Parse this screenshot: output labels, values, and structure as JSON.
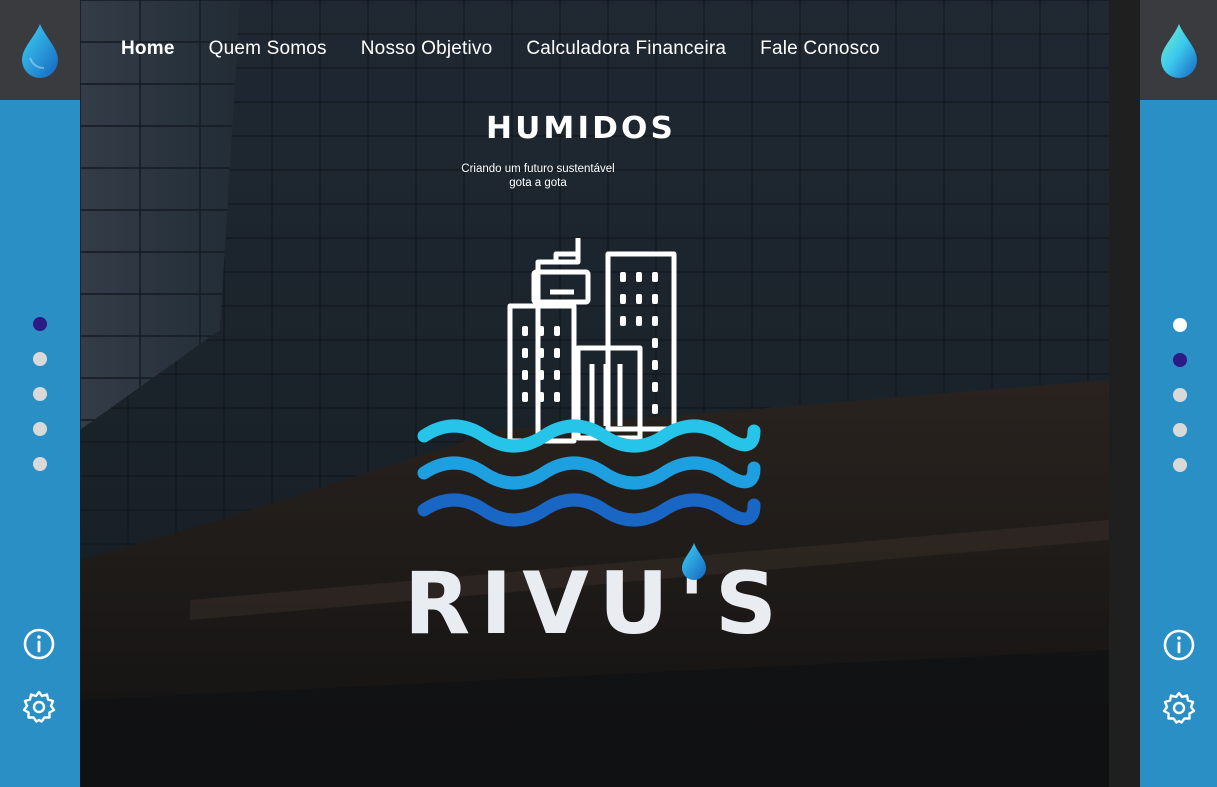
{
  "nav": {
    "items": [
      "Home",
      "Quem Somos",
      "Nosso Objetivo",
      "Calculadora Financeira",
      "Fale Conosco"
    ]
  },
  "brand": {
    "name": "HUMIDOS",
    "tagline_line1": "Criando um futuro sustentável",
    "tagline_line2": "gota a gota"
  },
  "hero": {
    "product_name": "RIVU'S"
  },
  "sidebar_left": {
    "active_dot": 1,
    "dot_count": 5,
    "icons": [
      "water-drop-logo-icon",
      "info-icon",
      "settings-icon"
    ]
  },
  "sidebar_right": {
    "active_dot": 2,
    "dot_count": 5,
    "icons": [
      "water-drop-logo-icon",
      "info-icon",
      "settings-icon"
    ]
  },
  "colors": {
    "sidebar": "#2a8fc4",
    "logo_box": "#3a3b3f",
    "active_dot": "#2c1b86",
    "inactive_dot": "#d9d9d9",
    "wave_light": "#27c4ea",
    "wave_mid": "#1e9fe0",
    "wave_dark": "#1a66c4"
  }
}
